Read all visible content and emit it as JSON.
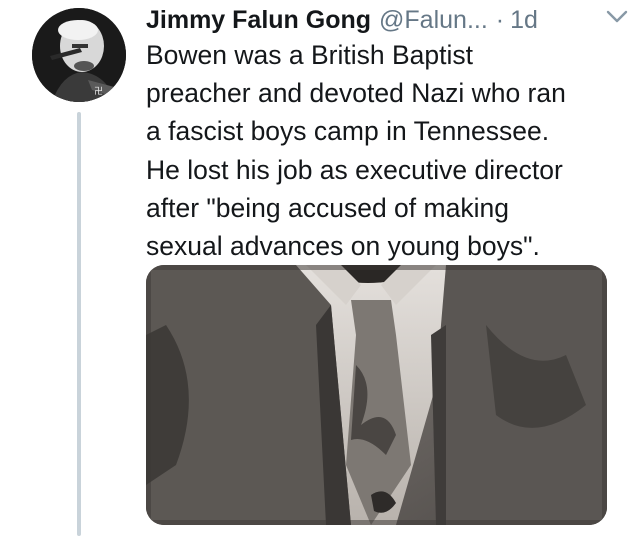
{
  "tweet": {
    "display_name": "Jimmy Falun Gong",
    "handle": "@Falun...",
    "separator": "·",
    "timestamp": "1d",
    "text": "Bowen was a British Baptist\npreacher and devoted Nazi who ran\na fascist boys camp in Tennessee.\nHe lost his job as executive director\nafter \"being accused of making\nsexual advances on young boys\".",
    "avatar_icon": "profile-photo",
    "menu_icon": "chevron-down-icon",
    "media_description_icon": "photo"
  },
  "colors": {
    "text_primary": "#14171a",
    "text_secondary": "#657786",
    "thread_line": "#c9d3da"
  }
}
